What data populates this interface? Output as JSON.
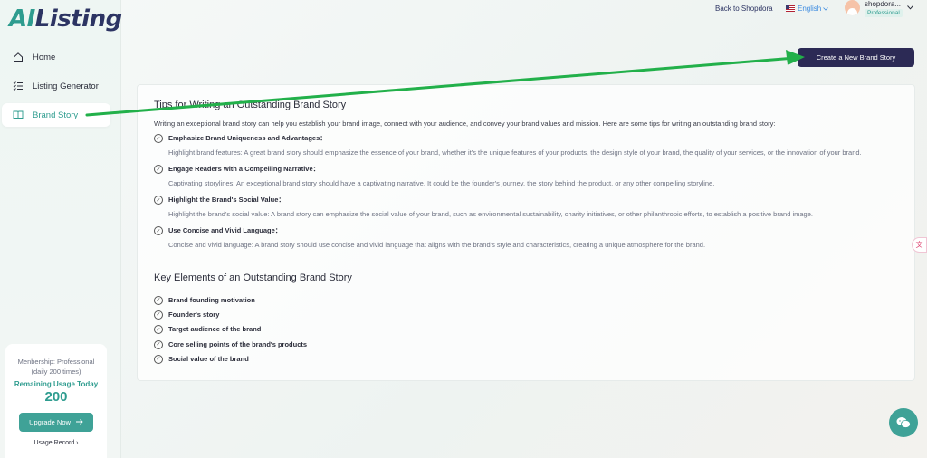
{
  "app": {
    "logo_ai": "AI",
    "logo_listing": "Listing"
  },
  "sidebar": {
    "items": [
      {
        "label": "Home",
        "icon": "home-icon",
        "active": false
      },
      {
        "label": "Listing Generator",
        "icon": "checklist-icon",
        "active": false
      },
      {
        "label": "Brand Story",
        "icon": "book-icon",
        "active": true
      }
    ],
    "membership": {
      "line1": "Menbership: Professional",
      "line2": "(daily 200 times)",
      "remaining_label": "Remaining Usage Today",
      "remaining_count": "200",
      "upgrade_label": "Upgrade Now",
      "usage_record_label": "Usage Record"
    }
  },
  "header": {
    "back_link": "Back to Shopdora",
    "language": "English",
    "user_name": "shopdora...",
    "user_badge": "Professional"
  },
  "create_button": "Create a New Brand Story",
  "tips": {
    "title": "Tips for Writing an Outstanding Brand Story",
    "intro": "Writing an exceptional brand story can help you establish your brand image, connect with your audience, and convey your brand values and mission. Here are some tips for writing an outstanding brand story:",
    "items": [
      {
        "title": "Emphasize Brand Uniqueness and Advantages：",
        "desc": "Highlight brand features: A great brand story should emphasize the essence of your brand, whether it's the unique features of your products, the design style of your brand, the quality of your services, or the innovation of your brand."
      },
      {
        "title": "Engage Readers with a Compelling Narrative：",
        "desc": "Captivating storylines: An exceptional brand story should have a captivating narrative. It could be the founder's journey, the story behind the product, or any other compelling storyline."
      },
      {
        "title": "Highlight the Brand's Social Value：",
        "desc": "Highlight the brand's social value: A brand story can emphasize the social value of your brand, such as environmental sustainability, charity initiatives, or other philanthropic efforts, to establish a positive brand image."
      },
      {
        "title": "Use Concise and Vivid Language：",
        "desc": "Concise and vivid language: A brand story should use concise and vivid language that aligns with the brand's style and characteristics, creating a unique atmosphere for the brand."
      }
    ]
  },
  "key_elements": {
    "title": "Key Elements of an Outstanding Brand Story",
    "items": [
      "Brand founding motivation",
      "Founder's story",
      "Target audience of the brand",
      "Core selling points of the brand's products",
      "Social value of the brand"
    ]
  },
  "colors": {
    "accent": "#2e9c8f",
    "dark_button": "#2c2a55",
    "arrow": "#22b04a"
  }
}
